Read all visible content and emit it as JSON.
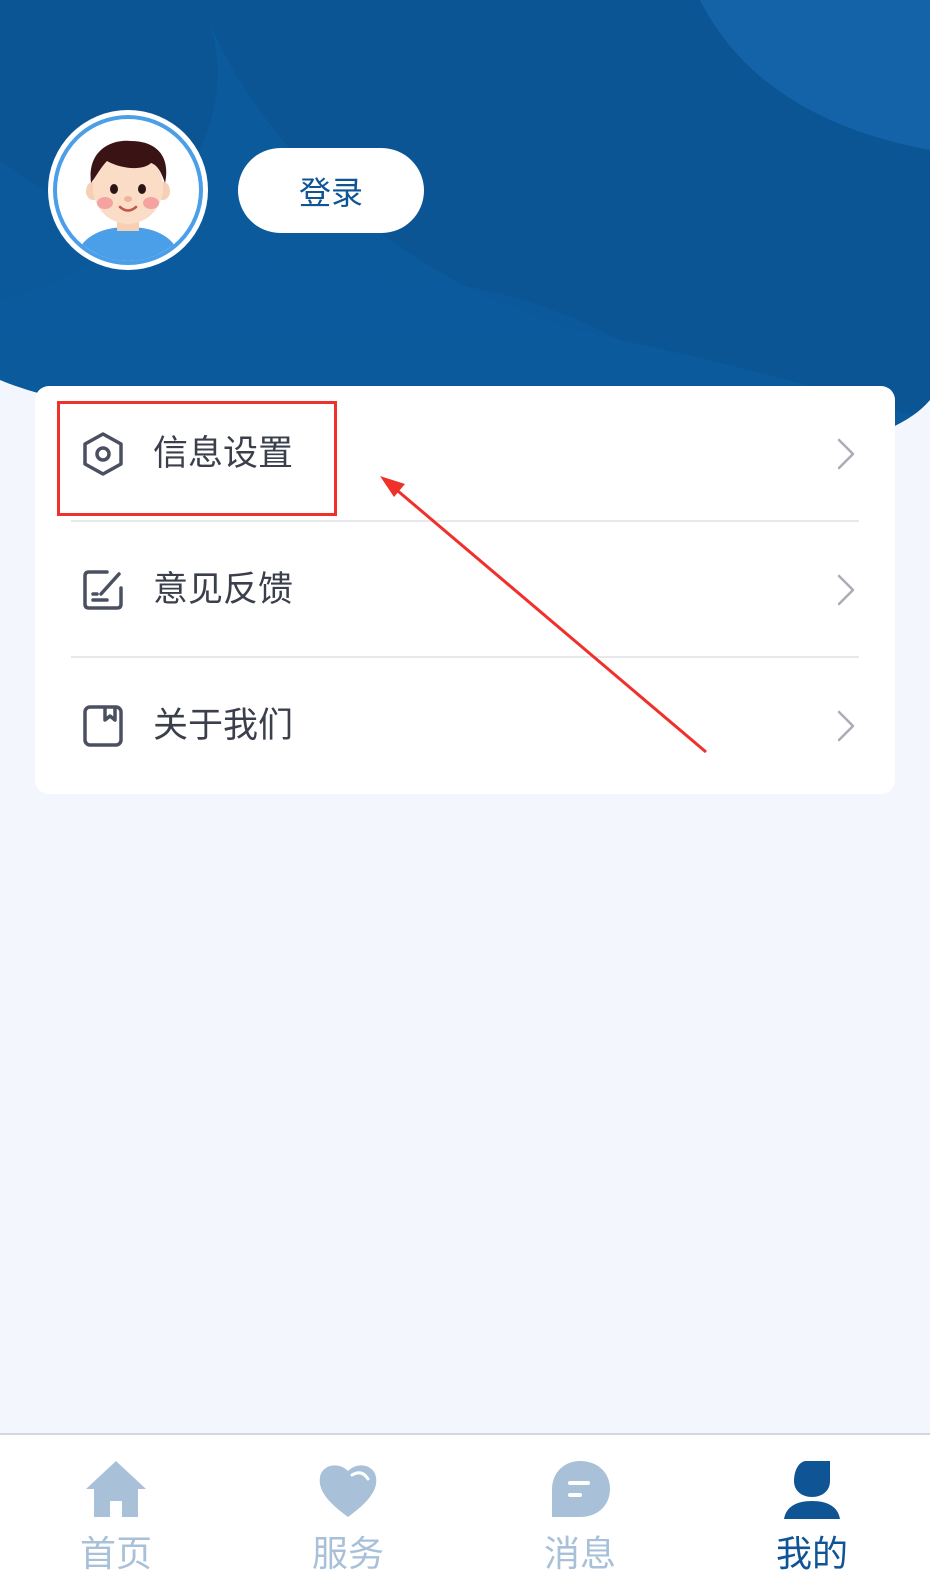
{
  "header": {
    "login_label": "登录",
    "colors": {
      "bg": "#0b5595",
      "bg_light": "#0e5fa6"
    }
  },
  "menu": {
    "items": [
      {
        "label": "信息设置",
        "icon": "settings-hexagon-icon"
      },
      {
        "label": "意见反馈",
        "icon": "feedback-edit-icon"
      },
      {
        "label": "关于我们",
        "icon": "about-bookmark-icon"
      }
    ]
  },
  "tabbar": {
    "tabs": [
      {
        "label": "首页",
        "icon": "home-icon",
        "active": false
      },
      {
        "label": "服务",
        "icon": "heart-icon",
        "active": false
      },
      {
        "label": "消息",
        "icon": "message-icon",
        "active": false
      },
      {
        "label": "我的",
        "icon": "user-icon",
        "active": true
      }
    ],
    "colors": {
      "active": "#0f5596",
      "inactive": "#a8c1d9"
    }
  },
  "annotation": {
    "color": "#f0302a"
  }
}
